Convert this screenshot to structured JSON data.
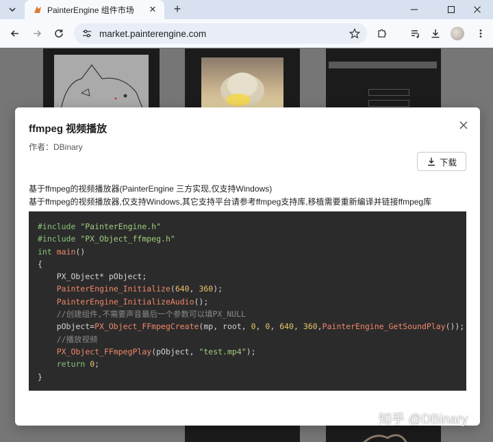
{
  "browser": {
    "tab_title": "PainterEngine 组件市场",
    "url": "market.painterengine.com"
  },
  "modal": {
    "title": "ffmpeg 视频播放",
    "author": "作者：DBinary",
    "download_label": "下载",
    "description_lines": [
      "基于ffmpeg的视频播放器(PainterEngine 三方实现,仅支持Windows)",
      "基于ffmpeg的视频播放器,仅支持Windows,其它支持平台请参考ffmpeg支持库,移植需要重新编译并链接ffmpeg库"
    ],
    "code_lines": [
      "#include \"PainterEngine.h\"",
      "#include \"PX_Object_ffmpeg.h\"",
      "int main()",
      "{",
      "    PX_Object* pObject;",
      "    PainterEngine_Initialize(640, 360);",
      "    PainterEngine_InitializeAudio();",
      "    //创建组件,不需要声音最后一个参数可以填PX_NULL",
      "    pObject=PX_Object_FFmpegCreate(mp, root, 0, 0, 640, 360,PainterEngine_GetSoundPlay());",
      "    //播放视频",
      "    PX_Object_FFmpegPlay(pObject, \"test.mp4\");",
      "    return 0;",
      "}"
    ]
  },
  "watermark": "知乎 @DBinary",
  "icons": {
    "tab_favicon": "painterengine-logo-icon",
    "tab_close": "close-icon",
    "new_tab": "plus-icon",
    "back": "arrow-left-icon",
    "forward": "arrow-right-icon",
    "reload": "reload-icon",
    "site_info": "tune-icon",
    "bookmark": "star-icon",
    "extensions": "puzzle-icon",
    "media": "playlist-icon",
    "downloads": "download-icon",
    "modal_close": "close-icon"
  },
  "colors": {
    "code_background": "#2b2b2b",
    "keyword": "#8ac57a",
    "string": "#9fcf7f",
    "function": "#f0876a",
    "number": "#e9c46a",
    "comment": "#8a8a8a"
  }
}
